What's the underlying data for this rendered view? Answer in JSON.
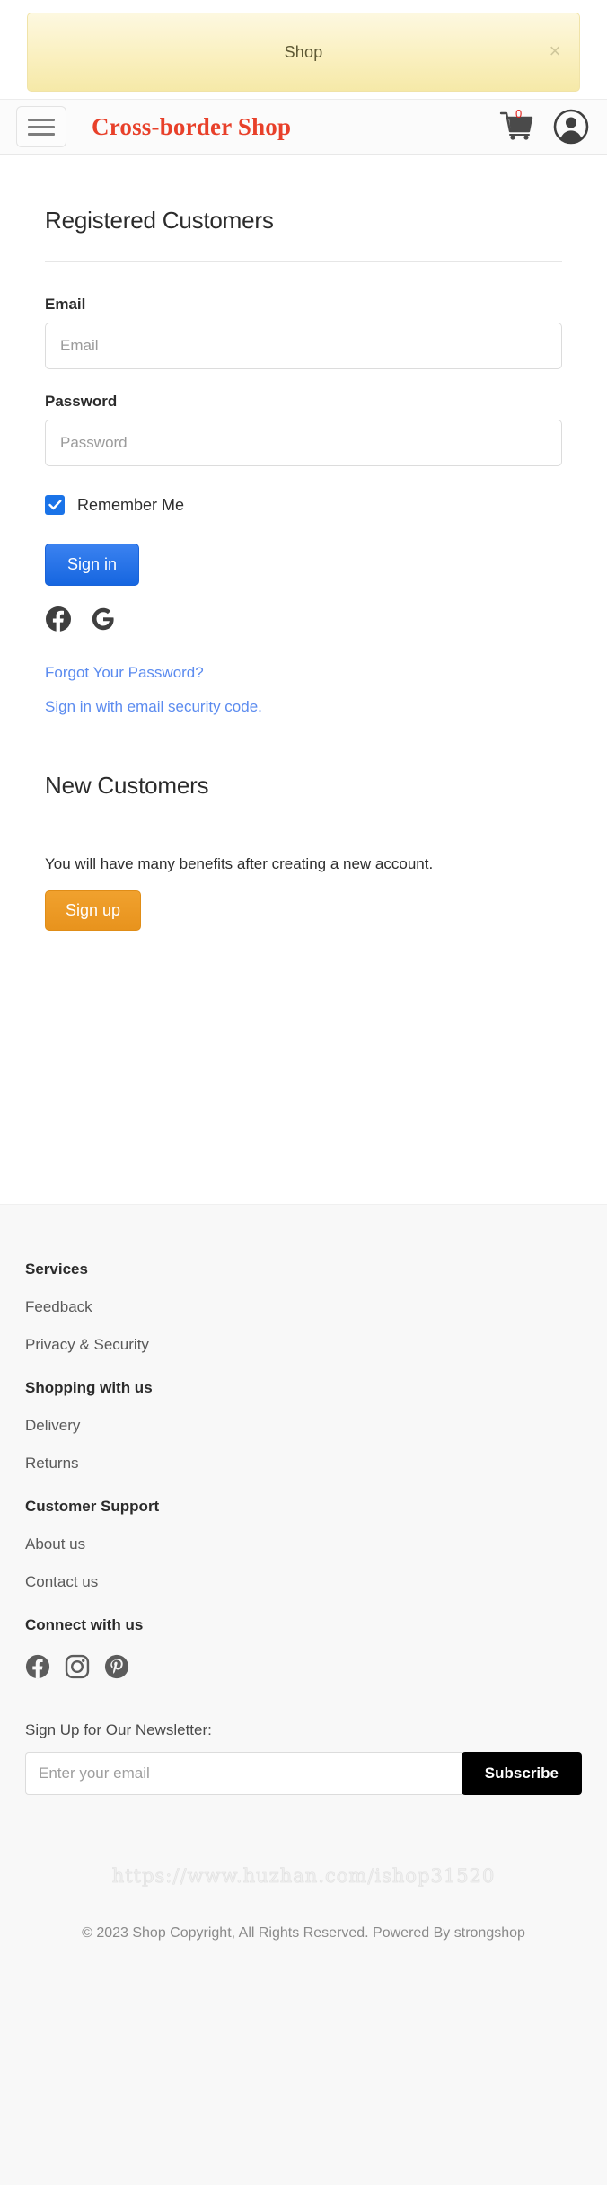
{
  "notice": {
    "text": "Shop",
    "close_label": "×"
  },
  "header": {
    "menu_icon": "hamburger-icon",
    "brand": "Cross-border Shop",
    "cart_count": "0",
    "cart_icon": "shopping-cart-icon",
    "account_icon": "user-account-icon"
  },
  "login": {
    "section_title": "Registered Customers",
    "email_label": "Email",
    "email_placeholder": "Email",
    "email_value": "",
    "password_label": "Password",
    "password_placeholder": "Password",
    "password_value": "",
    "remember_label": "Remember Me",
    "remember_checked": true,
    "signin_button": "Sign in",
    "social": [
      {
        "name": "facebook-signin-icon",
        "label": "Facebook"
      },
      {
        "name": "google-signin-icon",
        "label": "Google"
      }
    ],
    "forgot_link": "Forgot Your Password?",
    "security_code_link": "Sign in with email security code."
  },
  "new_customers": {
    "section_title": "New Customers",
    "description": "You will have many benefits after creating a new account.",
    "signup_button": "Sign up"
  },
  "footer": {
    "columns": [
      {
        "heading": "Services",
        "links": [
          "Feedback",
          "Privacy & Security"
        ]
      },
      {
        "heading": "Shopping with us",
        "links": [
          "Delivery",
          "Returns"
        ]
      },
      {
        "heading": "Customer Support",
        "links": [
          "About us",
          "Contact us"
        ]
      }
    ],
    "connect_heading": "Connect with us",
    "social": [
      {
        "name": "facebook-icon",
        "label": "Facebook"
      },
      {
        "name": "instagram-icon",
        "label": "Instagram"
      },
      {
        "name": "pinterest-icon",
        "label": "Pinterest"
      }
    ],
    "newsletter_label": "Sign Up for Our Newsletter:",
    "newsletter_placeholder": "Enter your email",
    "newsletter_value": "",
    "subscribe_button": "Subscribe",
    "watermark": "https://www.huzhan.com/ishop31520",
    "copyright": "© 2023 Shop Copyright, All Rights Reserved. Powered By strongshop"
  },
  "colors": {
    "brand_red": "#e8402a",
    "signin_blue": "#1a73e8",
    "signup_orange": "#e8931d",
    "link_blue": "#5b8bef",
    "notice_yellow": "#faf0c0",
    "subscribe_black": "#000000"
  }
}
